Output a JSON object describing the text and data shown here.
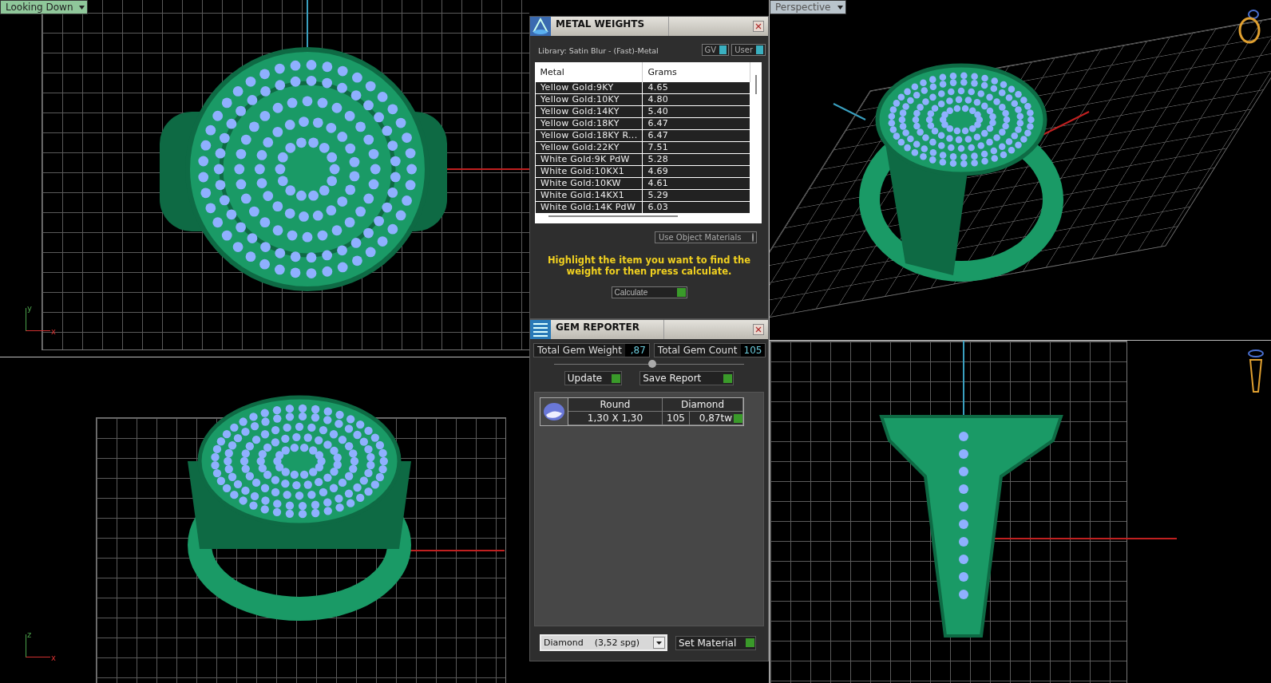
{
  "viewports": [
    {
      "kind": "top",
      "label": "Looking Down",
      "selected": true,
      "axes": [
        "y",
        "x"
      ]
    },
    {
      "kind": "perspective",
      "label": "Perspective",
      "selected": false
    },
    {
      "kind": "front",
      "axes": [
        "z",
        "x"
      ]
    },
    {
      "kind": "side"
    }
  ],
  "metal_weights": {
    "title": "METAL WEIGHTS",
    "library": "Library: Satin Blur - (Fast)-Metal",
    "toggles": [
      {
        "label": "GV",
        "on": true
      },
      {
        "label": "User",
        "on": true
      }
    ],
    "columns": [
      "Metal",
      "Grams"
    ],
    "rows": [
      {
        "metal": "Yellow Gold:9KY",
        "grams": "4.65"
      },
      {
        "metal": "Yellow Gold:10KY",
        "grams": "4.80"
      },
      {
        "metal": "Yellow Gold:14KY",
        "grams": "5.40"
      },
      {
        "metal": "Yellow Gold:18KY",
        "grams": "6.47"
      },
      {
        "metal": "Yellow Gold:18KY R...",
        "grams": "6.47"
      },
      {
        "metal": "Yellow Gold:22KY",
        "grams": "7.51"
      },
      {
        "metal": "White Gold:9K PdW",
        "grams": "5.28"
      },
      {
        "metal": "White Gold:10KX1",
        "grams": "4.69"
      },
      {
        "metal": "White Gold:10KW",
        "grams": "4.61"
      },
      {
        "metal": "White Gold:14KX1",
        "grams": "5.29"
      },
      {
        "metal": "White Gold:14K PdW",
        "grams": "6.03"
      }
    ],
    "use_object_materials": "Use Object Materials",
    "hint": "Highlight the item you want to find the weight for then press calculate.",
    "calculate": "Calculate"
  },
  "gem_reporter": {
    "title": "GEM REPORTER",
    "total_weight_label": "Total Gem Weight",
    "total_weight": ",87",
    "total_count_label": "Total Gem Count",
    "total_count": "105",
    "update": "Update",
    "save_report": "Save Report",
    "gems": [
      {
        "shape": "Round",
        "material": "Diamond",
        "size": "1,30 X 1,30",
        "count": "105",
        "weight": "0,87tw"
      }
    ],
    "material_select": "Diamond    (3,52 spg)",
    "set_material": "Set Material"
  }
}
